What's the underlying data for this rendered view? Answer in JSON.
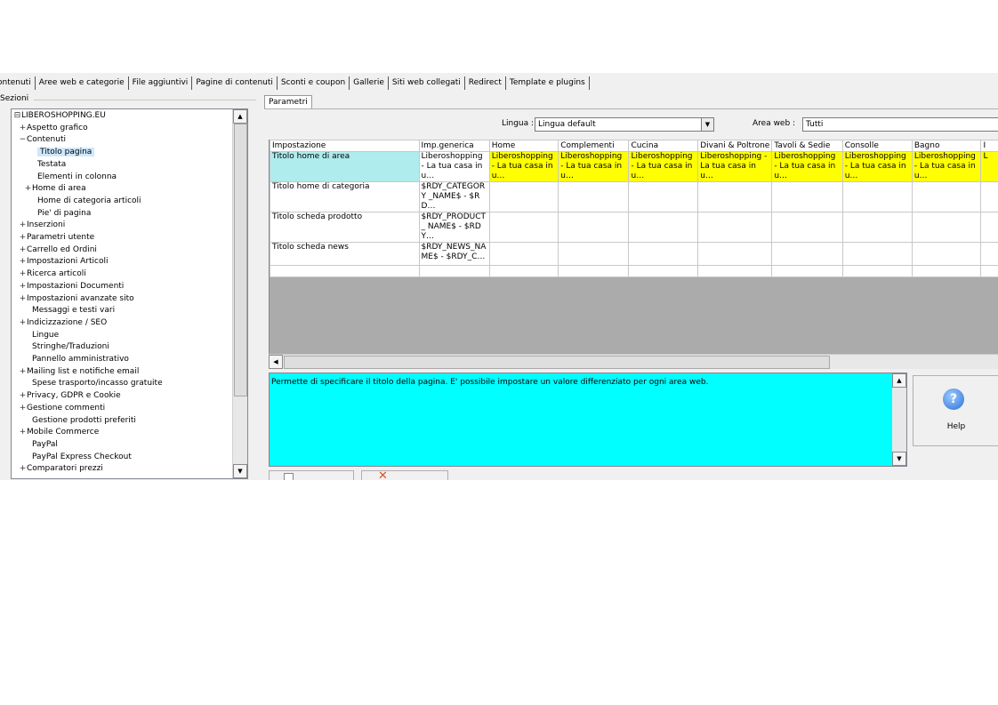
{
  "tabs": [
    "ontenuti",
    "Aree web e categorie",
    "File aggiuntivi",
    "Pagine di contenuti",
    "Sconti e coupon",
    "Gallerie",
    "Siti web collegati",
    "Redirect",
    "Template e plugins"
  ],
  "sections_label": "Sezioni",
  "tree": [
    {
      "label": "LIBEROSHOPPING.EU",
      "exp": "⊟"
    },
    {
      "label": "Aspetto grafico",
      "exp": "+"
    },
    {
      "label": "Contenuti",
      "exp": "−"
    },
    {
      "label": "Titolo pagina",
      "exp": ""
    },
    {
      "label": "Testata",
      "exp": ""
    },
    {
      "label": "Elementi in colonna",
      "exp": ""
    },
    {
      "label": "Home di area",
      "exp": "+"
    },
    {
      "label": "Home di categoria articoli",
      "exp": ""
    },
    {
      "label": "Pie' di pagina",
      "exp": ""
    },
    {
      "label": "Inserzioni",
      "exp": "+"
    },
    {
      "label": "Parametri utente",
      "exp": "+"
    },
    {
      "label": "Carrello ed Ordini",
      "exp": "+"
    },
    {
      "label": "Impostazioni Articoli",
      "exp": "+"
    },
    {
      "label": "Ricerca articoli",
      "exp": "+"
    },
    {
      "label": "Impostazioni Documenti",
      "exp": "+"
    },
    {
      "label": "Impostazioni avanzate sito",
      "exp": "+"
    },
    {
      "label": "Messaggi e testi vari",
      "exp": ""
    },
    {
      "label": "Indicizzazione / SEO",
      "exp": "+"
    },
    {
      "label": "Lingue",
      "exp": ""
    },
    {
      "label": "Stringhe/Traduzioni",
      "exp": ""
    },
    {
      "label": "Pannello amministrativo",
      "exp": ""
    },
    {
      "label": "Mailing list e notifiche email",
      "exp": "+"
    },
    {
      "label": "Spese trasporto/incasso gratuite",
      "exp": ""
    },
    {
      "label": "Privacy, GDPR e Cookie",
      "exp": "+"
    },
    {
      "label": "Gestione commenti",
      "exp": "+"
    },
    {
      "label": "Gestione prodotti preferiti",
      "exp": ""
    },
    {
      "label": "Mobile Commerce",
      "exp": "+"
    },
    {
      "label": "PayPal",
      "exp": ""
    },
    {
      "label": "PayPal Express Checkout",
      "exp": ""
    },
    {
      "label": "Comparatori prezzi",
      "exp": "+"
    }
  ],
  "params_tab": "Parametri",
  "lingua_label": "Lingua :",
  "lingua_value": "Lingua default",
  "area_label": "Area web :",
  "area_value": "Tutti",
  "grid": {
    "headers": [
      "Impostazione",
      "Imp.generica",
      "Home",
      "Complementi",
      "Cucina",
      "Divani & Poltrone",
      "Tavoli & Sedie",
      "Consolle",
      "Bagno",
      "I"
    ],
    "rows": [
      [
        "Titolo home di area",
        "Liberoshopping - La tua casa in u…",
        "Liberoshopping - La tua casa in u…",
        "Liberoshopping - La tua casa in u…",
        "Liberoshopping - La tua casa in u…",
        "Liberoshopping - La tua casa in u…",
        "Liberoshopping - La tua casa in u…",
        "Liberoshopping - La tua casa in u…",
        "Liberoshopping - La tua casa in u…",
        "L"
      ],
      [
        "Titolo home di categoria",
        "$RDY_CATEGORY _NAME$ - $RD…",
        "",
        "",
        "",
        "",
        "",
        "",
        "",
        ""
      ],
      [
        "Titolo scheda prodotto",
        "$RDY_PRODUCT_ NAME$ - $RDY…",
        "",
        "",
        "",
        "",
        "",
        "",
        "",
        ""
      ],
      [
        "Titolo scheda news",
        "$RDY_NEWS_NA ME$ - $RDY_C…",
        "",
        "",
        "",
        "",
        "",
        "",
        "",
        ""
      ]
    ]
  },
  "description": "Permette di specificare il titolo della pagina. E' possibile impostare un valore differenziato per ogni area web.",
  "help_label": "Help",
  "colors": {
    "desc_bg": "#00ffff",
    "selected_cell": "#aeecee",
    "yellow_cell": "#ffff00",
    "grid_empty": "#ababab"
  }
}
